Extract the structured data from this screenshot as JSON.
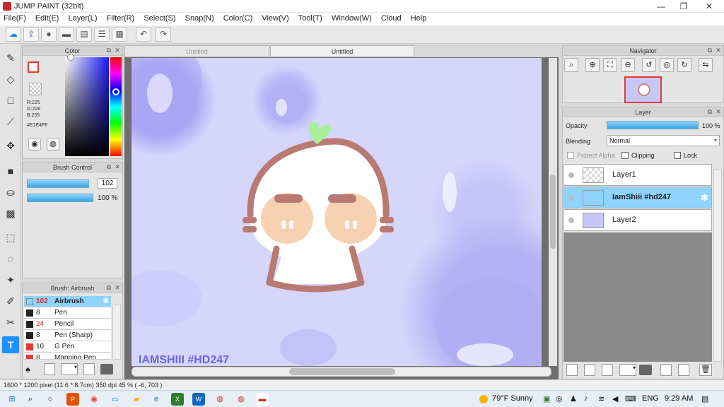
{
  "window": {
    "title": "JUMP PAINT (32bit)",
    "minimize": "—",
    "maximize": "❐",
    "close": "✕"
  },
  "menu": [
    "File(F)",
    "Edit(E)",
    "Layer(L)",
    "Filter(R)",
    "Select(S)",
    "Snap(N)",
    "Color(C)",
    "View(V)",
    "Tool(T)",
    "Window(W)",
    "Cloud",
    "Help"
  ],
  "toolbar": {
    "undo_icon": "↶",
    "redo_icon": "↷"
  },
  "color_panel": {
    "title": "Color",
    "r": "R:225",
    "g": "G:228",
    "b": "B:255",
    "hex": "#E1E4FF",
    "main_color": "#E1E4FF"
  },
  "brush_control": {
    "title": "Brush Control",
    "size": "102",
    "opacity": "100 %",
    "size_fraction": 0.9,
    "opacity_fraction": 1.0
  },
  "brush_list": {
    "title": "Brush: Airbrush",
    "items": [
      {
        "size": "102",
        "name": "Airbrush",
        "color": "#ffffff"
      },
      {
        "size": "8",
        "name": "Pen",
        "color": "#222222"
      },
      {
        "size": "24",
        "name": "Pencil",
        "color": "#222222"
      },
      {
        "size": "8",
        "name": "Pen (Sharp)",
        "color": "#222222"
      },
      {
        "size": "10",
        "name": "G Pen",
        "color": "#e53935"
      },
      {
        "size": "8",
        "name": "Mapping Pen",
        "color": "#e53935"
      }
    ]
  },
  "tabs": [
    "Untitled",
    "Untitled"
  ],
  "canvas": {
    "watermark": "IAMSHIII #HD247",
    "bg_color": "#d6d5fb",
    "accent": "#b97a72"
  },
  "navigator": {
    "title": "Navigator"
  },
  "layer_panel": {
    "title": "Layer",
    "opacity_label": "Opacity",
    "opacity_value": "100 %",
    "opacity_fraction": 1.0,
    "blending_label": "Blending",
    "blending_value": "Normal",
    "protect_alpha": "Protect Alpha",
    "clipping": "Clipping",
    "lock": "Lock",
    "layers": [
      {
        "name": "Layer1",
        "selected": false
      },
      {
        "name": "IamShiii #hd247",
        "selected": true
      },
      {
        "name": "Layer2",
        "selected": false
      }
    ]
  },
  "status": {
    "text": "1600 * 1200 pixel  (11.6 * 8.7cm)  350 dpi  45 %  ( -6, 703 )"
  },
  "taskbar": {
    "weather": "79°F  Sunny",
    "lang": "ENG",
    "time": "9:29 AM"
  }
}
